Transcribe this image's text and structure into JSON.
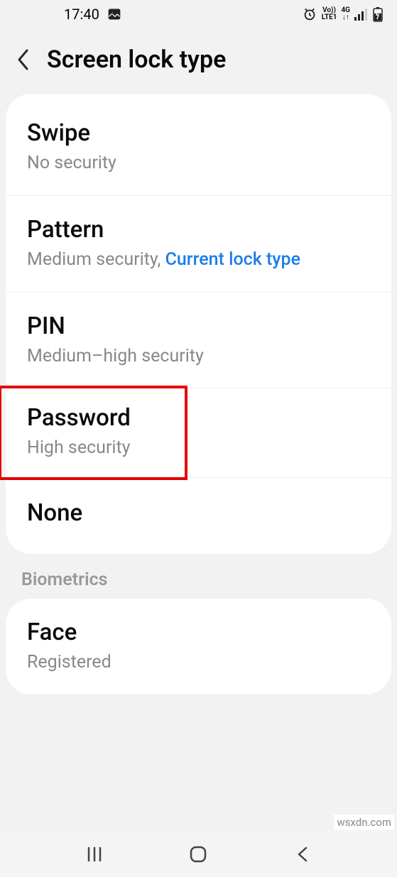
{
  "statusbar": {
    "time": "17:40"
  },
  "header": {
    "title": "Screen lock type"
  },
  "items": {
    "swipe": {
      "title": "Swipe",
      "sub": "No security"
    },
    "pattern": {
      "title": "Pattern",
      "sub_prefix": "Medium security, ",
      "sub_current": "Current lock type"
    },
    "pin": {
      "title": "PIN",
      "sub": "Medium–high security"
    },
    "password": {
      "title": "Password",
      "sub": "High security"
    },
    "none": {
      "title": "None"
    }
  },
  "section": {
    "biometrics": "Biometrics"
  },
  "biometrics": {
    "face": {
      "title": "Face",
      "sub": "Registered"
    }
  },
  "watermark": "wsxdn.com"
}
